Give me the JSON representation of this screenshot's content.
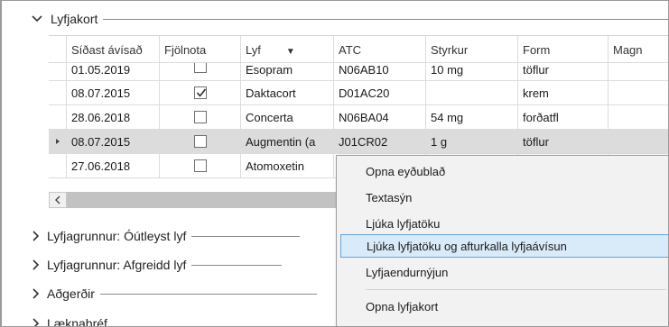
{
  "sections": {
    "drug_card": "Lyfjakort",
    "group_not_dispensed": "Lyfjagrunnur: Óútleyst lyf",
    "group_dispensed": "Lyfjagrunnur: Afgreidd lyf",
    "actions": "Aðgerðir",
    "letters": "Læknabréf"
  },
  "grid": {
    "columns": [
      "Síðast ávísað",
      "Fjölnota",
      "Lyf",
      "ATC",
      "Styrkur",
      "Form",
      "Magn"
    ],
    "rows": [
      {
        "date": "01.05.2019",
        "reusable": false,
        "drug": "Esopram",
        "atc": "N06AB10",
        "strength": "10 mg",
        "form": "töflur",
        "amount": ""
      },
      {
        "date": "08.07.2015",
        "reusable": true,
        "drug": "Daktacort",
        "atc": "D01AC20",
        "strength": "",
        "form": "krem",
        "amount": ""
      },
      {
        "date": "28.06.2018",
        "reusable": false,
        "drug": "Concerta",
        "atc": "N06BA04",
        "strength": "54 mg",
        "form": "forðatfl",
        "amount": ""
      },
      {
        "date": "08.07.2015",
        "reusable": false,
        "drug": "Augmentin (a",
        "atc": "J01CR02",
        "strength": "1 g",
        "form": "töflur",
        "amount": ""
      },
      {
        "date": "27.06.2018",
        "reusable": false,
        "drug": "Atomoxetin",
        "atc": "",
        "strength": "",
        "form": "",
        "amount": ""
      }
    ]
  },
  "context_menu": {
    "items": [
      "Opna eyðublað",
      "Textasýn",
      "Ljúka lyfjatöku",
      "Ljúka lyfjatöku og afturkalla lyfjaávísun",
      "Lyfjaendurnýjun",
      "Opna lyfjakort"
    ]
  }
}
